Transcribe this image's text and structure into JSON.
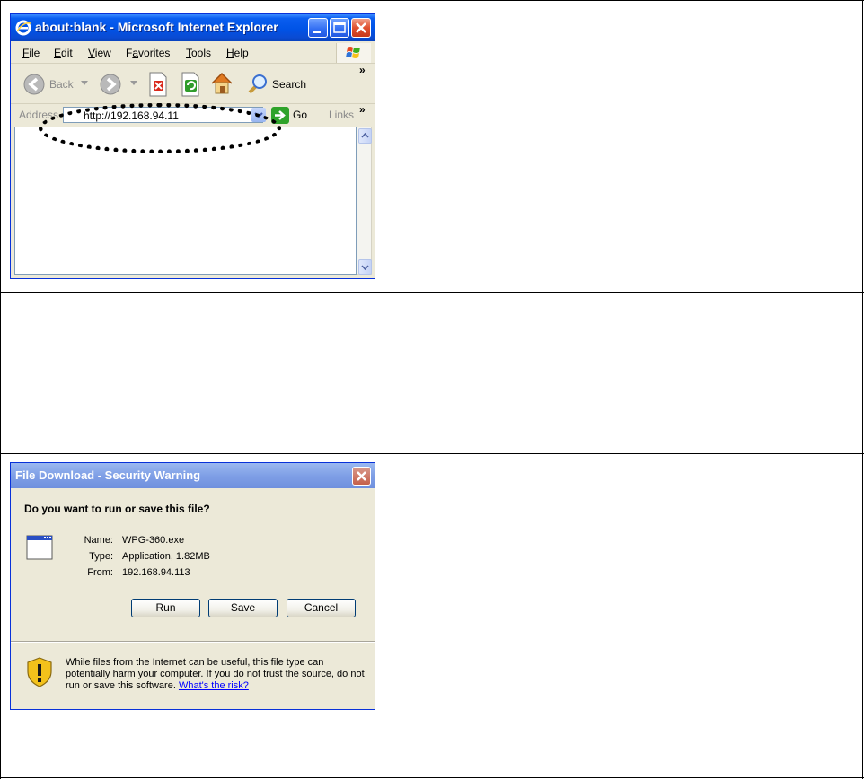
{
  "ie_window": {
    "title": "about:blank - Microsoft Internet Explorer",
    "menu": [
      "File",
      "Edit",
      "View",
      "Favorites",
      "Tools",
      "Help"
    ],
    "menu_accel": [
      "F",
      "E",
      "V",
      "a",
      "T",
      "H"
    ],
    "toolbar": {
      "back_label": "Back",
      "search_label": "Search",
      "chevron": "»"
    },
    "address": {
      "label": "Address",
      "value": "http://192.168.94.11",
      "go_label": "Go",
      "links_label": "Links",
      "chevron": "»"
    },
    "icons": {
      "ie": "ie-logo-icon",
      "back": "back-arrow-icon",
      "forward": "forward-arrow-icon",
      "stop": "stop-icon",
      "refresh": "refresh-icon",
      "home": "home-icon",
      "search": "magnifier-icon",
      "go": "go-arrow-icon"
    },
    "colors": {
      "titlebar": "#0053e6",
      "close": "#e0502e"
    }
  },
  "download_dialog": {
    "title": "File Download - Security Warning",
    "question": "Do you want to run or save this file?",
    "file": {
      "name_label": "Name:",
      "name_value": "WPG-360.exe",
      "type_label": "Type:",
      "type_value": "Application, 1.82MB",
      "from_label": "From:",
      "from_value": "192.168.94.113"
    },
    "buttons": {
      "run": "Run",
      "save": "Save",
      "cancel": "Cancel"
    },
    "warning_text": "While files from the Internet can be useful, this file type can potentially harm your computer. If you do not trust the source, do not run or save this software.",
    "warning_link": "What's the risk?",
    "colors": {
      "titlebar": "#7f9fe6",
      "link": "#0000ff"
    }
  }
}
